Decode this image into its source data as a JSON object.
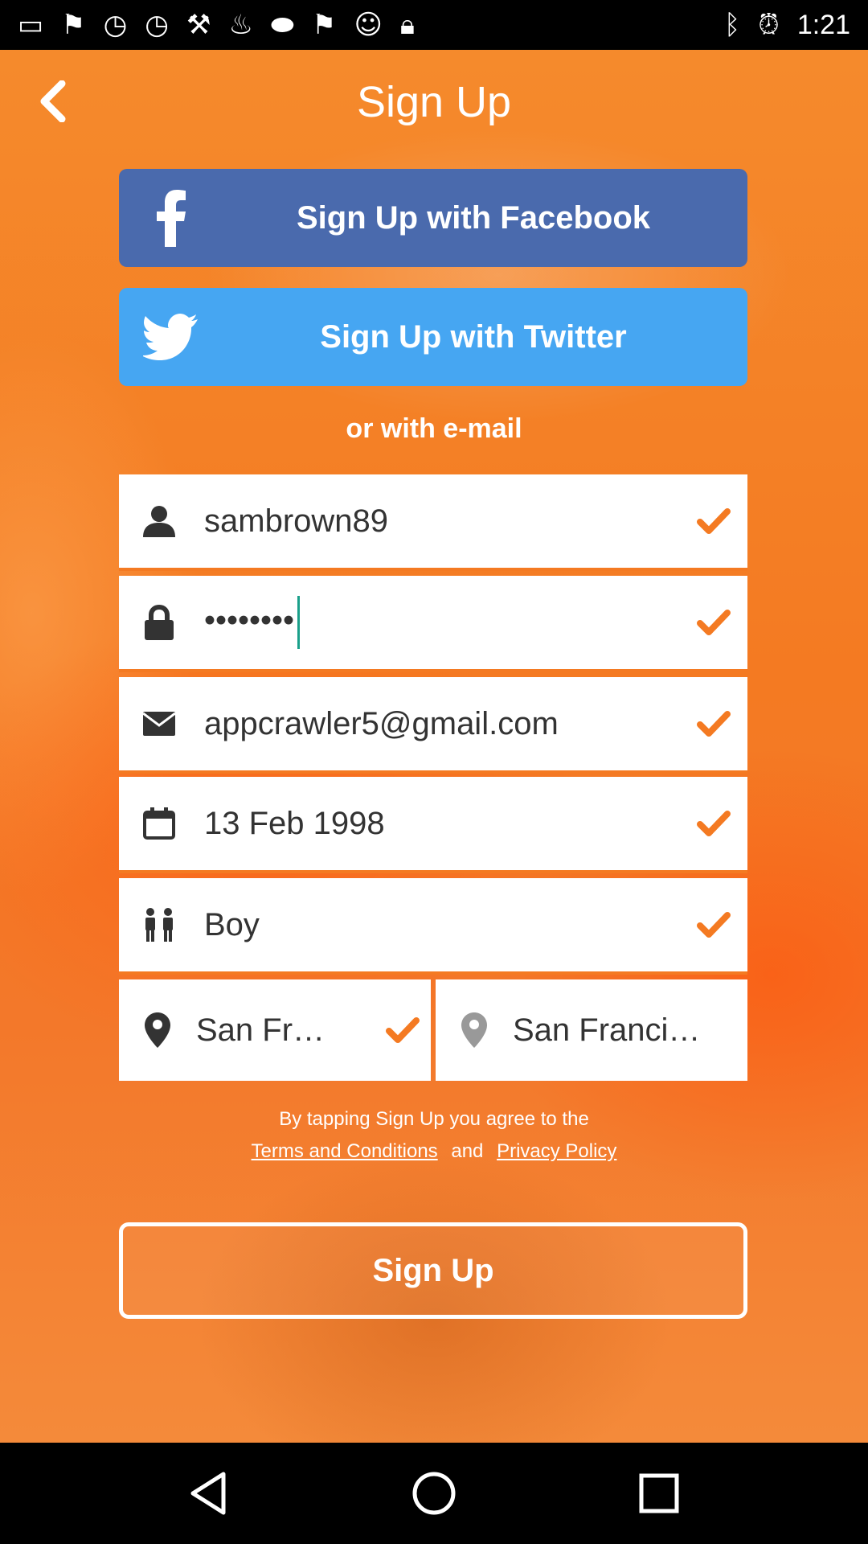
{
  "status_bar": {
    "time": "1:21",
    "left_icons": [
      "message-icon",
      "flag-icon",
      "timer-icon",
      "timer-icon",
      "wrench-icon",
      "steam-icon",
      "fox-sports-icon",
      "flag-icon",
      "smiley-icon",
      "lock-icon"
    ],
    "right_icons": [
      "bluetooth-icon",
      "alarm-icon"
    ]
  },
  "header": {
    "title": "Sign Up",
    "back_icon": "chevron-left-icon"
  },
  "social": {
    "facebook_label": "Sign Up with Facebook",
    "twitter_label": "Sign Up with Twitter",
    "facebook_color": "#4a6aad",
    "twitter_color": "#46a6f2"
  },
  "or_email_label": "or with e-mail",
  "form": {
    "username": "sambrown89",
    "password": "••••••••",
    "email": "appcrawler5@gmail.com",
    "birthdate": "13 Feb 1998",
    "gender": "Boy",
    "city": "San Fr…",
    "city_alt": "San Franci…"
  },
  "agreement": {
    "text": "By tapping Sign Up you agree to the",
    "terms": "Terms and Conditions",
    "and": "and",
    "privacy": "Privacy Policy"
  },
  "signup_button": "Sign Up",
  "colors": {
    "accent": "#f47a22",
    "check": "#f47a22"
  }
}
